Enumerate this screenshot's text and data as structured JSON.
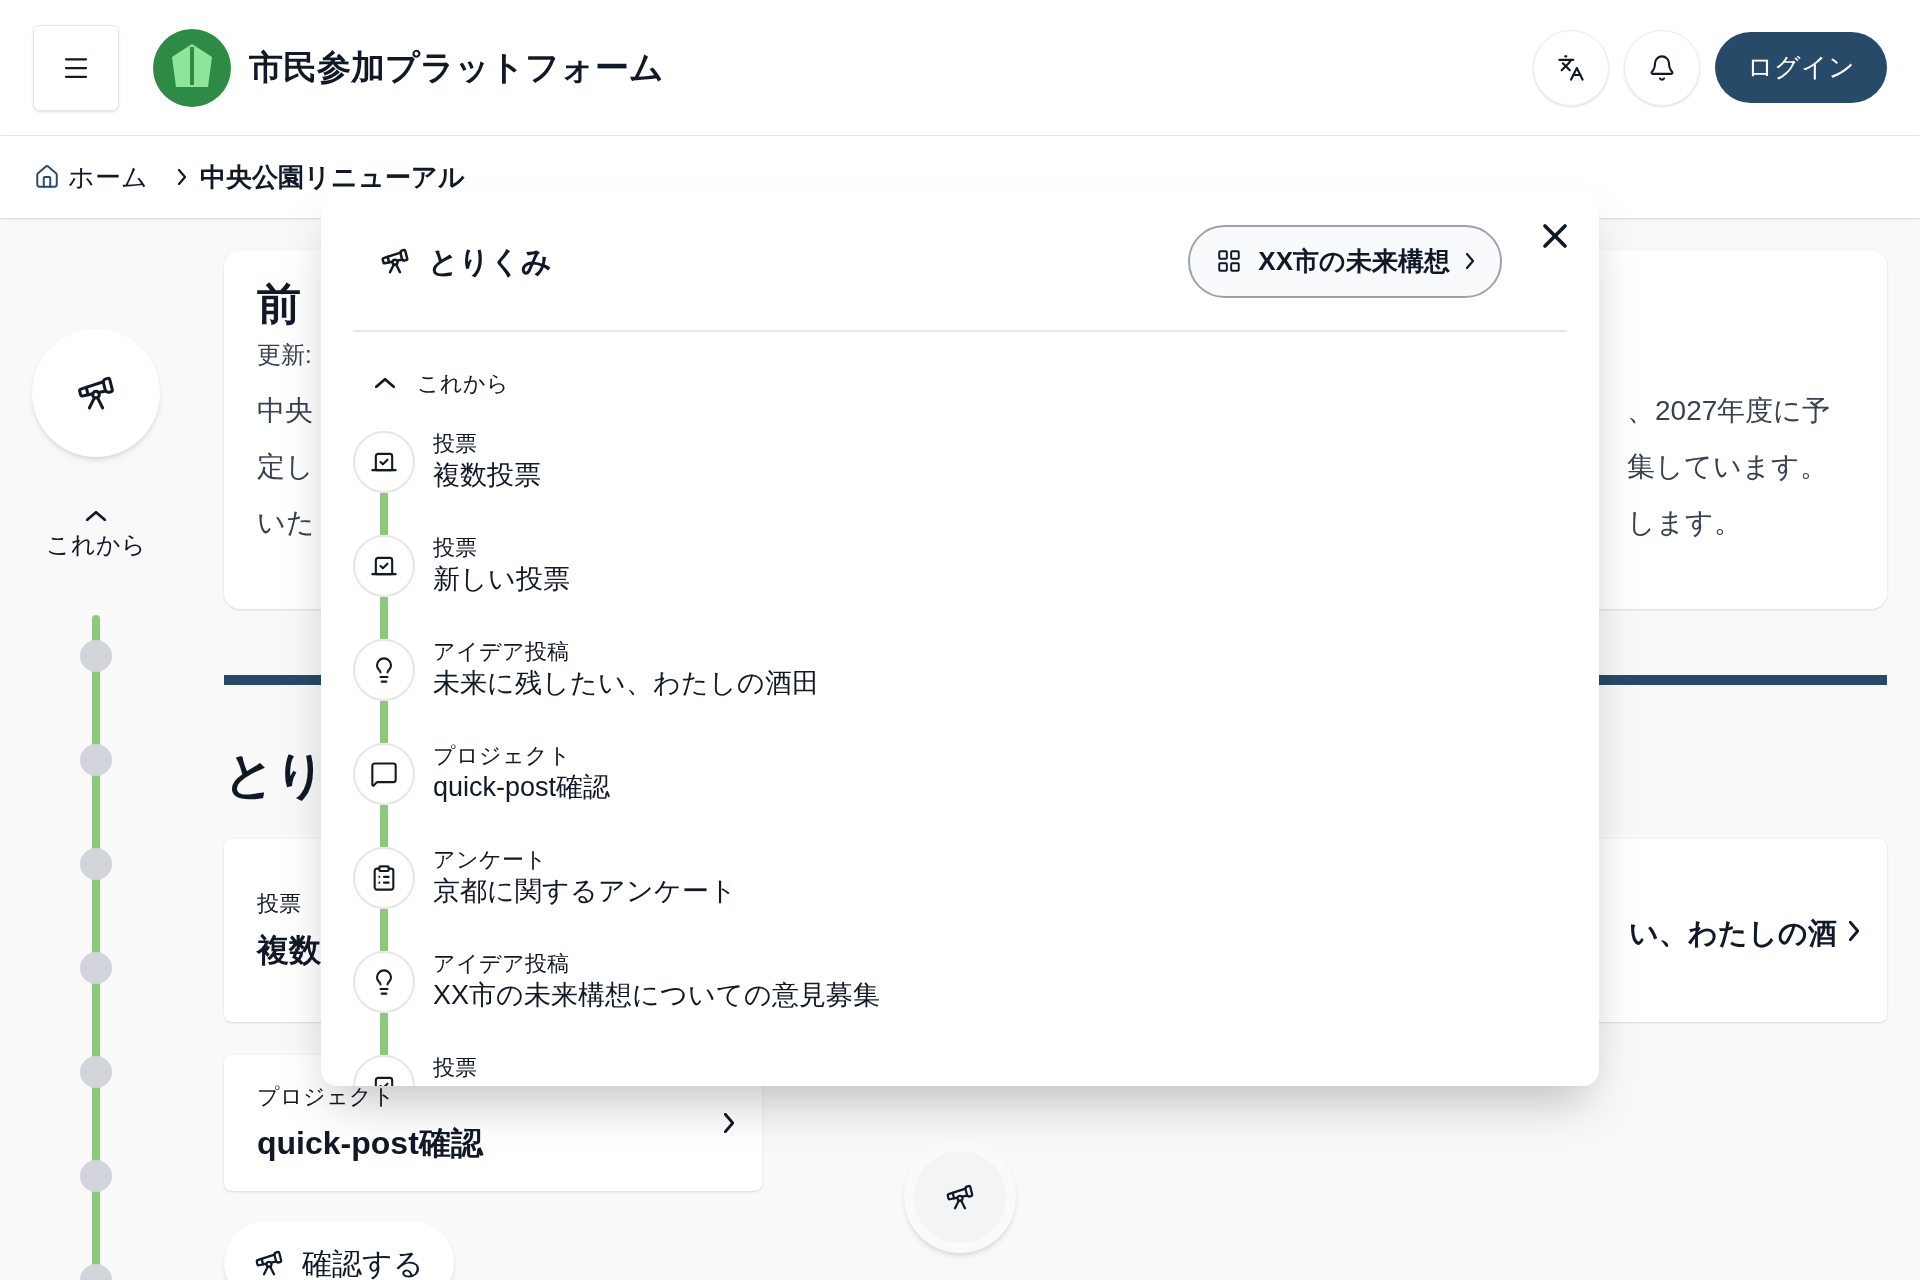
{
  "header": {
    "title": "市民参加プラットフォーム",
    "login": "ログイン"
  },
  "breadcrumb": {
    "home": "ホーム",
    "current": "中央公園リニューアル"
  },
  "rail": {
    "expanded": true,
    "label": "これから"
  },
  "intro_card": {
    "title": "前",
    "updated": "更新:",
    "lines": [
      {
        "left": "中央",
        "right": "、2027年度に予"
      },
      {
        "left": "定し",
        "right": "集しています。"
      },
      {
        "left": "いた",
        "right": "します。"
      }
    ]
  },
  "section_heading": "とり",
  "cards": [
    {
      "label": "投票",
      "title": "複数"
    },
    {
      "title": "い、わたしの酒",
      "chevron": true
    },
    {
      "label": "プロジェクト",
      "title": "quick-post確認",
      "chevron": true
    }
  ],
  "confirm_button": "確認する",
  "modal": {
    "title": "とりくみ",
    "link": "XX市の未来構想",
    "section": {
      "label": "これから",
      "expanded": true
    },
    "items": [
      {
        "kind": "vote",
        "label": "投票",
        "title": "複数投票"
      },
      {
        "kind": "vote",
        "label": "投票",
        "title": "新しい投票"
      },
      {
        "kind": "idea",
        "label": "アイデア投稿",
        "title": "未来に残したい、わたしの酒田"
      },
      {
        "kind": "project",
        "label": "プロジェクト",
        "title": "quick-post確認"
      },
      {
        "kind": "survey",
        "label": "アンケート",
        "title": "京都に関するアンケート"
      },
      {
        "kind": "idea",
        "label": "アイデア投稿",
        "title": "XX市の未来構想についての意見募集"
      },
      {
        "kind": "vote",
        "label": "投票"
      }
    ]
  }
}
